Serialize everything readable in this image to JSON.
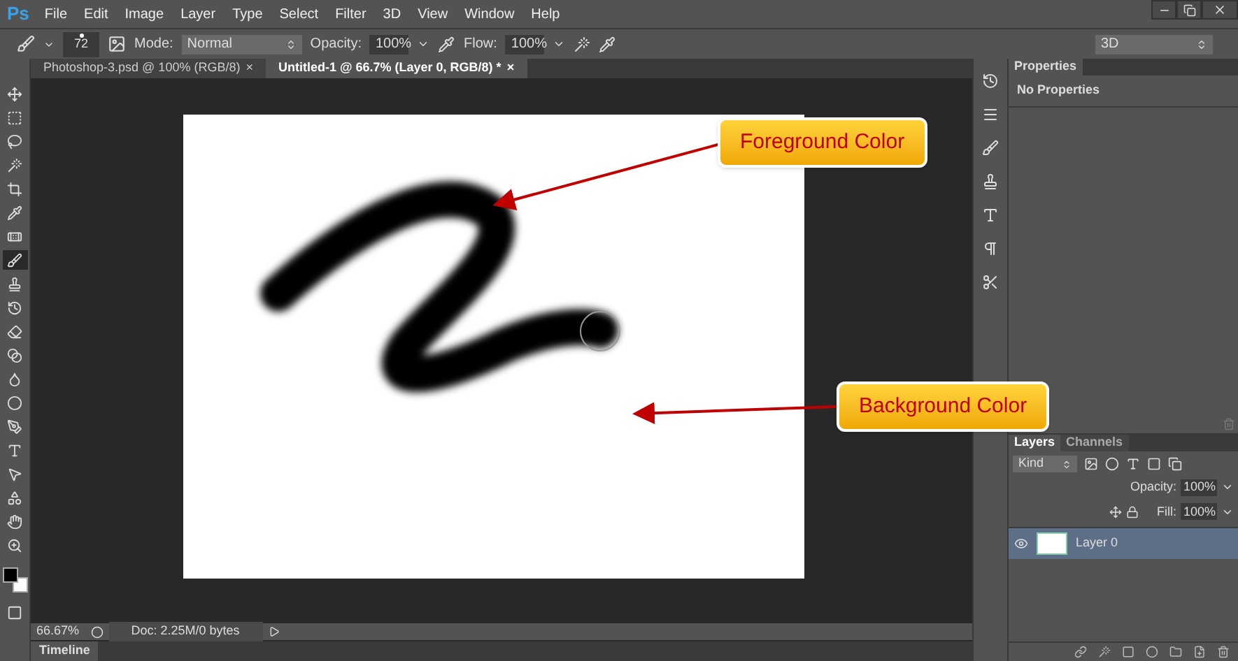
{
  "app_logo": "Ps",
  "menu": [
    "File",
    "Edit",
    "Image",
    "Layer",
    "Type",
    "Select",
    "Filter",
    "3D",
    "View",
    "Window",
    "Help"
  ],
  "options_bar": {
    "brush_size": "72",
    "mode_label": "Mode:",
    "mode_value": "Normal",
    "opacity_label": "Opacity:",
    "opacity_value": "100%",
    "flow_label": "Flow:",
    "flow_value": "100%",
    "workspace": "3D"
  },
  "doc_tabs": [
    {
      "label": "Photoshop-3.psd @ 100% (RGB/8)",
      "close": "×",
      "selected": false
    },
    {
      "label": "Untitled-1 @ 66.7% (Layer 0, RGB/8) *",
      "close": "×",
      "selected": true
    }
  ],
  "tools": [
    {
      "kind": "move",
      "selected": false
    },
    {
      "kind": "marquee",
      "selected": false
    },
    {
      "kind": "lasso",
      "selected": false
    },
    {
      "kind": "wand",
      "selected": false
    },
    {
      "kind": "crop",
      "selected": false
    },
    {
      "kind": "eyedropper",
      "selected": false
    },
    {
      "kind": "healing",
      "selected": false
    },
    {
      "kind": "brush",
      "selected": true
    },
    {
      "kind": "stamp",
      "selected": false
    },
    {
      "kind": "history",
      "selected": false
    },
    {
      "kind": "eraser",
      "selected": false
    },
    {
      "kind": "gradient",
      "selected": false
    },
    {
      "kind": "blur",
      "selected": false
    },
    {
      "kind": "dodge",
      "selected": false
    },
    {
      "kind": "pen",
      "selected": false
    },
    {
      "kind": "type",
      "selected": false
    },
    {
      "kind": "select",
      "selected": false
    },
    {
      "kind": "shape",
      "selected": false
    },
    {
      "kind": "hand",
      "selected": false
    },
    {
      "kind": "zoom",
      "selected": false
    }
  ],
  "callouts": [
    {
      "text": "Foreground Color"
    },
    {
      "text": "Background Color"
    }
  ],
  "properties_panel": {
    "title": "Properties",
    "message": "No Properties"
  },
  "layers_panel": {
    "tabs": [
      {
        "label": "Layers",
        "selected": true
      },
      {
        "label": "Channels",
        "selected": false
      }
    ],
    "filter": "Kind",
    "opacity_label": "Opacity:",
    "opacity_value": "100%",
    "fill_label": "Fill:",
    "fill_value": "100%",
    "layers": [
      {
        "name": "Layer 0",
        "visible": true,
        "selected": true
      }
    ]
  },
  "status_bar": {
    "zoom": "66.67%",
    "doc_info": "Doc: 2.25M/0 bytes"
  },
  "bottom_tab": "Timeline"
}
